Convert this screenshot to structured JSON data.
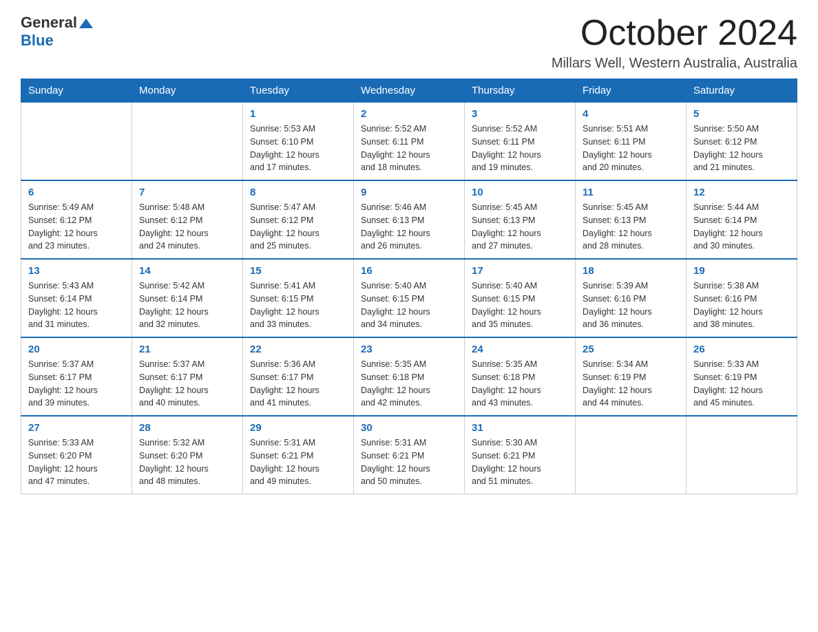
{
  "logo": {
    "general": "General",
    "blue": "Blue"
  },
  "title": "October 2024",
  "location": "Millars Well, Western Australia, Australia",
  "headers": [
    "Sunday",
    "Monday",
    "Tuesday",
    "Wednesday",
    "Thursday",
    "Friday",
    "Saturday"
  ],
  "weeks": [
    [
      {
        "day": "",
        "info": ""
      },
      {
        "day": "",
        "info": ""
      },
      {
        "day": "1",
        "info": "Sunrise: 5:53 AM\nSunset: 6:10 PM\nDaylight: 12 hours\nand 17 minutes."
      },
      {
        "day": "2",
        "info": "Sunrise: 5:52 AM\nSunset: 6:11 PM\nDaylight: 12 hours\nand 18 minutes."
      },
      {
        "day": "3",
        "info": "Sunrise: 5:52 AM\nSunset: 6:11 PM\nDaylight: 12 hours\nand 19 minutes."
      },
      {
        "day": "4",
        "info": "Sunrise: 5:51 AM\nSunset: 6:11 PM\nDaylight: 12 hours\nand 20 minutes."
      },
      {
        "day": "5",
        "info": "Sunrise: 5:50 AM\nSunset: 6:12 PM\nDaylight: 12 hours\nand 21 minutes."
      }
    ],
    [
      {
        "day": "6",
        "info": "Sunrise: 5:49 AM\nSunset: 6:12 PM\nDaylight: 12 hours\nand 23 minutes."
      },
      {
        "day": "7",
        "info": "Sunrise: 5:48 AM\nSunset: 6:12 PM\nDaylight: 12 hours\nand 24 minutes."
      },
      {
        "day": "8",
        "info": "Sunrise: 5:47 AM\nSunset: 6:12 PM\nDaylight: 12 hours\nand 25 minutes."
      },
      {
        "day": "9",
        "info": "Sunrise: 5:46 AM\nSunset: 6:13 PM\nDaylight: 12 hours\nand 26 minutes."
      },
      {
        "day": "10",
        "info": "Sunrise: 5:45 AM\nSunset: 6:13 PM\nDaylight: 12 hours\nand 27 minutes."
      },
      {
        "day": "11",
        "info": "Sunrise: 5:45 AM\nSunset: 6:13 PM\nDaylight: 12 hours\nand 28 minutes."
      },
      {
        "day": "12",
        "info": "Sunrise: 5:44 AM\nSunset: 6:14 PM\nDaylight: 12 hours\nand 30 minutes."
      }
    ],
    [
      {
        "day": "13",
        "info": "Sunrise: 5:43 AM\nSunset: 6:14 PM\nDaylight: 12 hours\nand 31 minutes."
      },
      {
        "day": "14",
        "info": "Sunrise: 5:42 AM\nSunset: 6:14 PM\nDaylight: 12 hours\nand 32 minutes."
      },
      {
        "day": "15",
        "info": "Sunrise: 5:41 AM\nSunset: 6:15 PM\nDaylight: 12 hours\nand 33 minutes."
      },
      {
        "day": "16",
        "info": "Sunrise: 5:40 AM\nSunset: 6:15 PM\nDaylight: 12 hours\nand 34 minutes."
      },
      {
        "day": "17",
        "info": "Sunrise: 5:40 AM\nSunset: 6:15 PM\nDaylight: 12 hours\nand 35 minutes."
      },
      {
        "day": "18",
        "info": "Sunrise: 5:39 AM\nSunset: 6:16 PM\nDaylight: 12 hours\nand 36 minutes."
      },
      {
        "day": "19",
        "info": "Sunrise: 5:38 AM\nSunset: 6:16 PM\nDaylight: 12 hours\nand 38 minutes."
      }
    ],
    [
      {
        "day": "20",
        "info": "Sunrise: 5:37 AM\nSunset: 6:17 PM\nDaylight: 12 hours\nand 39 minutes."
      },
      {
        "day": "21",
        "info": "Sunrise: 5:37 AM\nSunset: 6:17 PM\nDaylight: 12 hours\nand 40 minutes."
      },
      {
        "day": "22",
        "info": "Sunrise: 5:36 AM\nSunset: 6:17 PM\nDaylight: 12 hours\nand 41 minutes."
      },
      {
        "day": "23",
        "info": "Sunrise: 5:35 AM\nSunset: 6:18 PM\nDaylight: 12 hours\nand 42 minutes."
      },
      {
        "day": "24",
        "info": "Sunrise: 5:35 AM\nSunset: 6:18 PM\nDaylight: 12 hours\nand 43 minutes."
      },
      {
        "day": "25",
        "info": "Sunrise: 5:34 AM\nSunset: 6:19 PM\nDaylight: 12 hours\nand 44 minutes."
      },
      {
        "day": "26",
        "info": "Sunrise: 5:33 AM\nSunset: 6:19 PM\nDaylight: 12 hours\nand 45 minutes."
      }
    ],
    [
      {
        "day": "27",
        "info": "Sunrise: 5:33 AM\nSunset: 6:20 PM\nDaylight: 12 hours\nand 47 minutes."
      },
      {
        "day": "28",
        "info": "Sunrise: 5:32 AM\nSunset: 6:20 PM\nDaylight: 12 hours\nand 48 minutes."
      },
      {
        "day": "29",
        "info": "Sunrise: 5:31 AM\nSunset: 6:21 PM\nDaylight: 12 hours\nand 49 minutes."
      },
      {
        "day": "30",
        "info": "Sunrise: 5:31 AM\nSunset: 6:21 PM\nDaylight: 12 hours\nand 50 minutes."
      },
      {
        "day": "31",
        "info": "Sunrise: 5:30 AM\nSunset: 6:21 PM\nDaylight: 12 hours\nand 51 minutes."
      },
      {
        "day": "",
        "info": ""
      },
      {
        "day": "",
        "info": ""
      }
    ]
  ]
}
